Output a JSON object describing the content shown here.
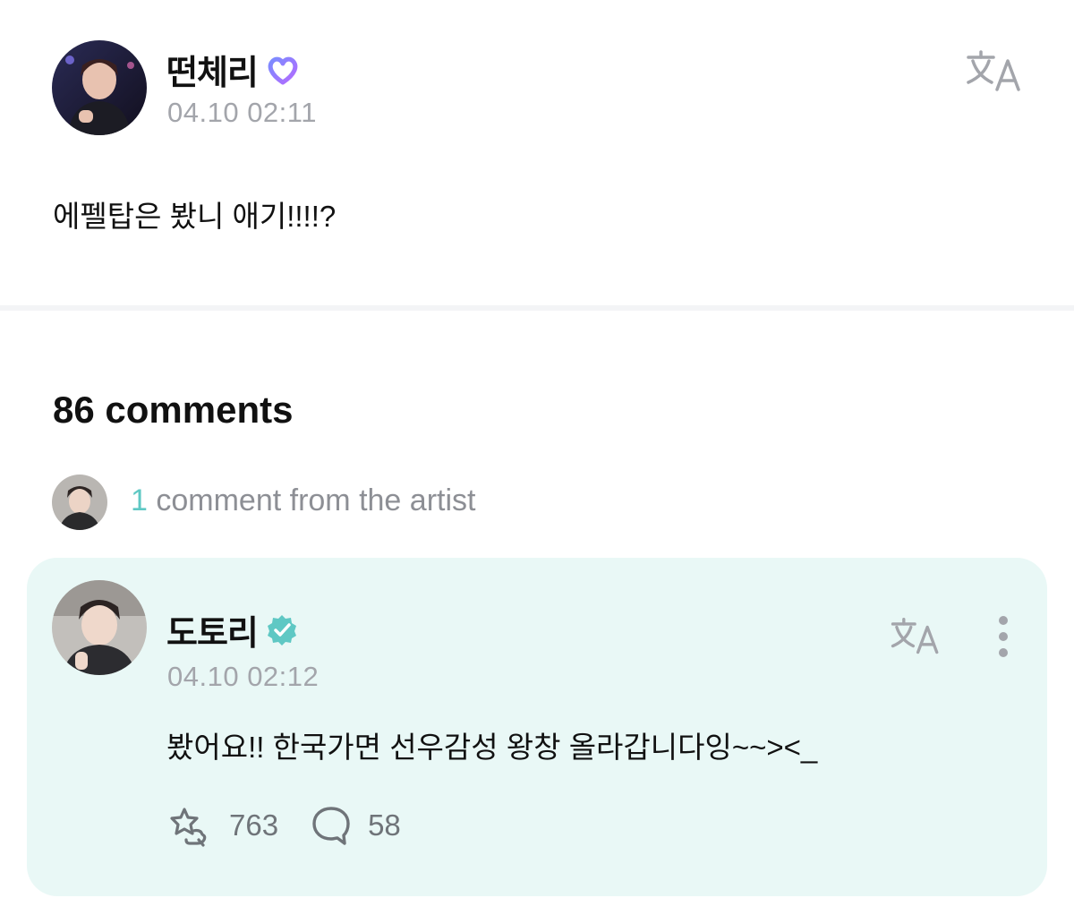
{
  "post": {
    "author": "떤체리",
    "timestamp": "04.10 02:11",
    "text": "에펠탑은 봤니 애기!!!!?"
  },
  "comments": {
    "count_label": "86 comments",
    "artist_count": "1",
    "artist_label": " comment from the artist"
  },
  "artist_comment": {
    "author": "도토리",
    "timestamp": "04.10 02:12",
    "text": "봤어요!! 한국가면 선우감성 왕창 올라갑니다잉~~><_",
    "likes": "763",
    "replies": "58"
  },
  "icons": {
    "post_badge": "heart-badge-icon",
    "artist_badge": "verified-badge-icon",
    "translate": "translate-icon",
    "more": "more-vertical-icon",
    "like": "star-hand-icon",
    "reply": "comment-bubble-icon"
  },
  "colors": {
    "teal_accent": "#5fc8c4",
    "card_bg": "#e9f8f6",
    "muted_text": "#a3a5ab",
    "badge_purple": "#8a6cf0"
  }
}
